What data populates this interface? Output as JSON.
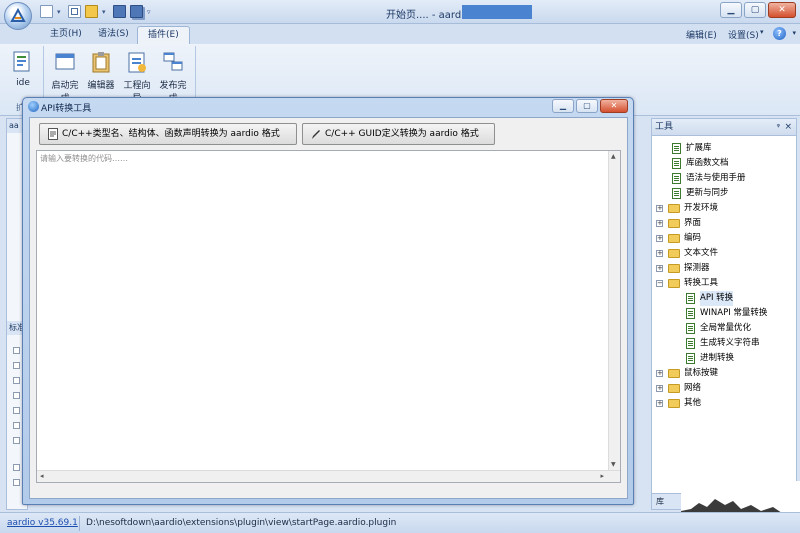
{
  "window": {
    "title": "开始页.... - aardio"
  },
  "ribbon": {
    "tabs": [
      {
        "label": "主页(H)"
      },
      {
        "label": "语法(S)"
      },
      {
        "label": "插件(E)"
      }
    ],
    "right_menus": [
      {
        "label": "编辑(E)"
      },
      {
        "label": "设置(S)"
      }
    ],
    "help_symbol": "?",
    "buttons": [
      {
        "label": "ide"
      },
      {
        "label": "启动完成"
      },
      {
        "label": "编辑器"
      },
      {
        "label": "工程向导"
      },
      {
        "label": "发布完成"
      }
    ],
    "group_label": "扩"
  },
  "left_pane": {
    "header_top": "aa",
    "header_bottom": "标准"
  },
  "dialog": {
    "title": "API转换工具",
    "button_struct": "C/C++类型名、结构体、函数声明转换为 aardio 格式",
    "button_guid": "C/C++ GUID定义转换为 aardio 格式",
    "placeholder": "请输入要转换的代码……"
  },
  "tools_pane": {
    "title": "工具",
    "pin": "ᵠ",
    "close": "×",
    "bottom_tab": "库",
    "items": [
      {
        "label": "扩展库",
        "kind": "doc",
        "indent": 1
      },
      {
        "label": "库函数文档",
        "kind": "doc",
        "indent": 1
      },
      {
        "label": "语法与使用手册",
        "kind": "doc",
        "indent": 1
      },
      {
        "label": "更新与同步",
        "kind": "doc",
        "indent": 1
      },
      {
        "label": "开发环境",
        "kind": "folder",
        "indent": 0
      },
      {
        "label": "界面",
        "kind": "folder",
        "indent": 0
      },
      {
        "label": "编码",
        "kind": "folder",
        "indent": 0
      },
      {
        "label": "文本文件",
        "kind": "folder",
        "indent": 0
      },
      {
        "label": "探测器",
        "kind": "folder",
        "indent": 0
      },
      {
        "label": "转换工具",
        "kind": "folder",
        "indent": 0,
        "expanded": true
      },
      {
        "label": "API 转换",
        "kind": "doc",
        "indent": 2,
        "selected": true
      },
      {
        "label": "WINAPI 常量转换",
        "kind": "doc",
        "indent": 2
      },
      {
        "label": "全局常量优化",
        "kind": "doc",
        "indent": 2
      },
      {
        "label": "生成转义字符串",
        "kind": "doc",
        "indent": 2
      },
      {
        "label": "进制转换",
        "kind": "doc",
        "indent": 2
      },
      {
        "label": "鼠标按键",
        "kind": "folder",
        "indent": 0
      },
      {
        "label": "网络",
        "kind": "folder",
        "indent": 0
      },
      {
        "label": "其他",
        "kind": "folder",
        "indent": 0
      }
    ]
  },
  "statusbar": {
    "version": "aardio v35.69.1",
    "path": "D:\\nesoftdown\\aardio\\extensions\\plugin\\view\\startPage.aardio.plugin"
  },
  "colors": {
    "accent": "#4a83d0",
    "ribbon_bg": "#dbe7f5",
    "dialog_frame": "#b2cbea"
  }
}
